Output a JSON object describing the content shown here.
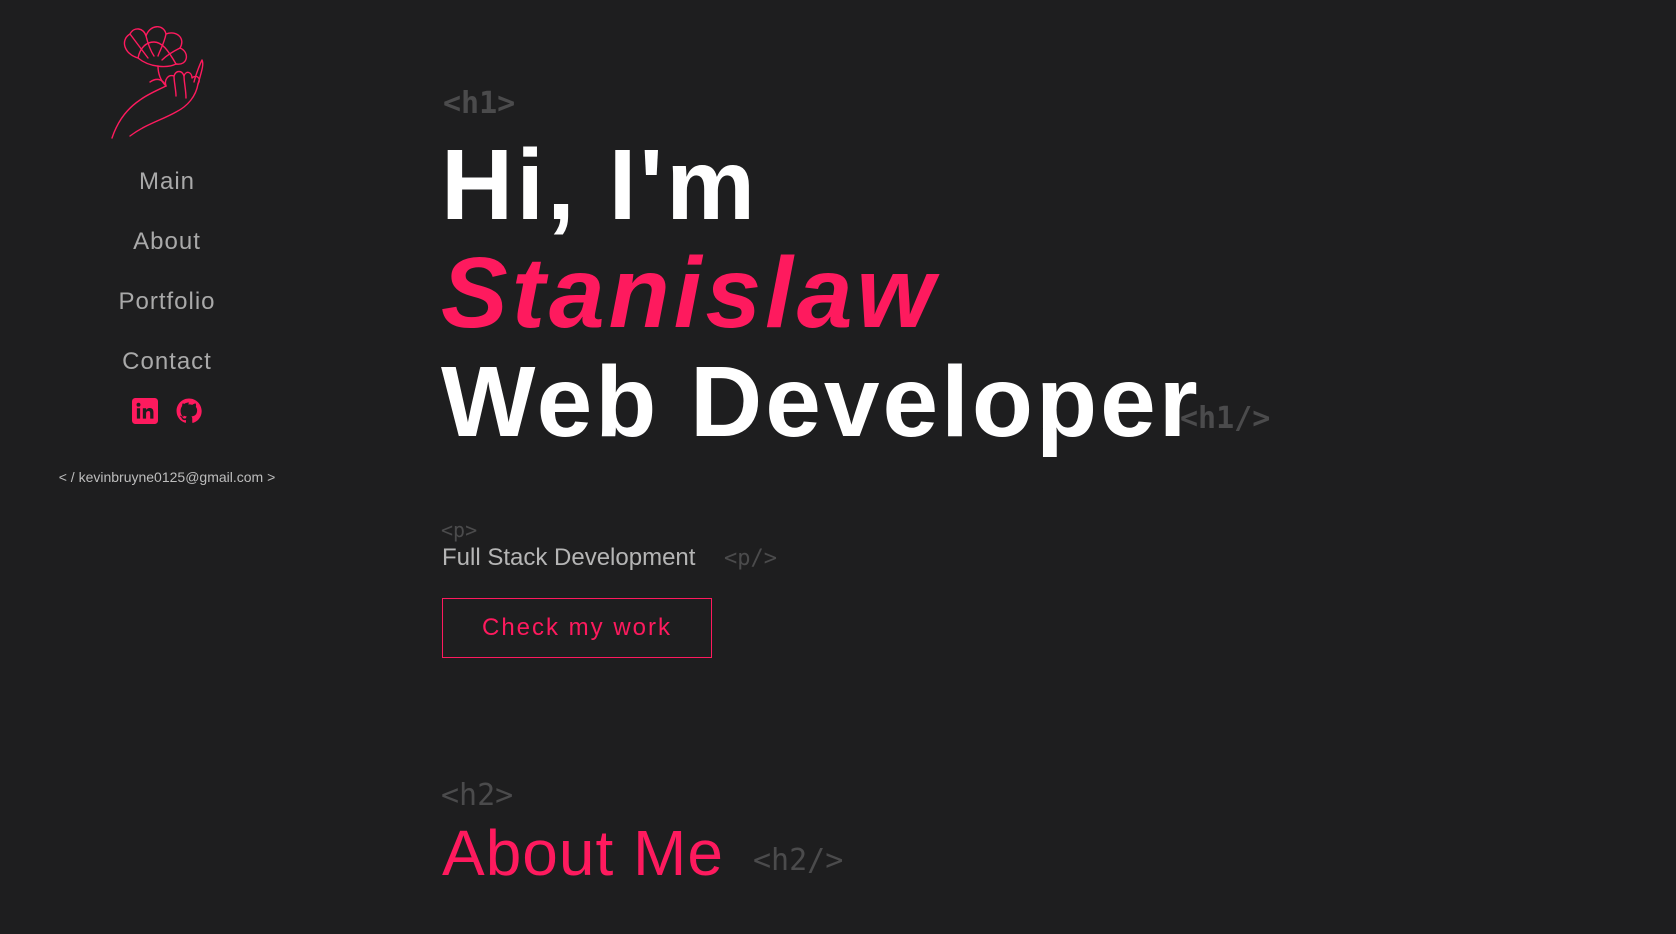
{
  "colors": {
    "background": "#1e1e1f",
    "accent": "#fe1a5e",
    "nav_text": "#a9a9a9",
    "code_tag": "#4b4b4c"
  },
  "sidebar": {
    "logo_icon": "hand-with-flower-icon",
    "nav": [
      {
        "label": "Main"
      },
      {
        "label": "About"
      },
      {
        "label": "Portfolio"
      },
      {
        "label": "Contact"
      }
    ],
    "socials": [
      {
        "icon": "linkedin-icon"
      },
      {
        "icon": "github-icon"
      }
    ],
    "email": "< / kevinbruyne0125@gmail.com >"
  },
  "hero": {
    "h1_open_tag": "<h1>",
    "line1": "Hi, I'm",
    "line2": "Stanislaw",
    "line3": "Web Developer",
    "h1_close_tag": "<h1/>",
    "p_open_tag": "<p>",
    "subtitle": "Full Stack Development",
    "p_close_tag": "<p/>",
    "cta_label": "Check my work"
  },
  "about": {
    "h2_open_tag": "<h2>",
    "title": "About Me",
    "h2_close_tag": "<h2/>"
  }
}
